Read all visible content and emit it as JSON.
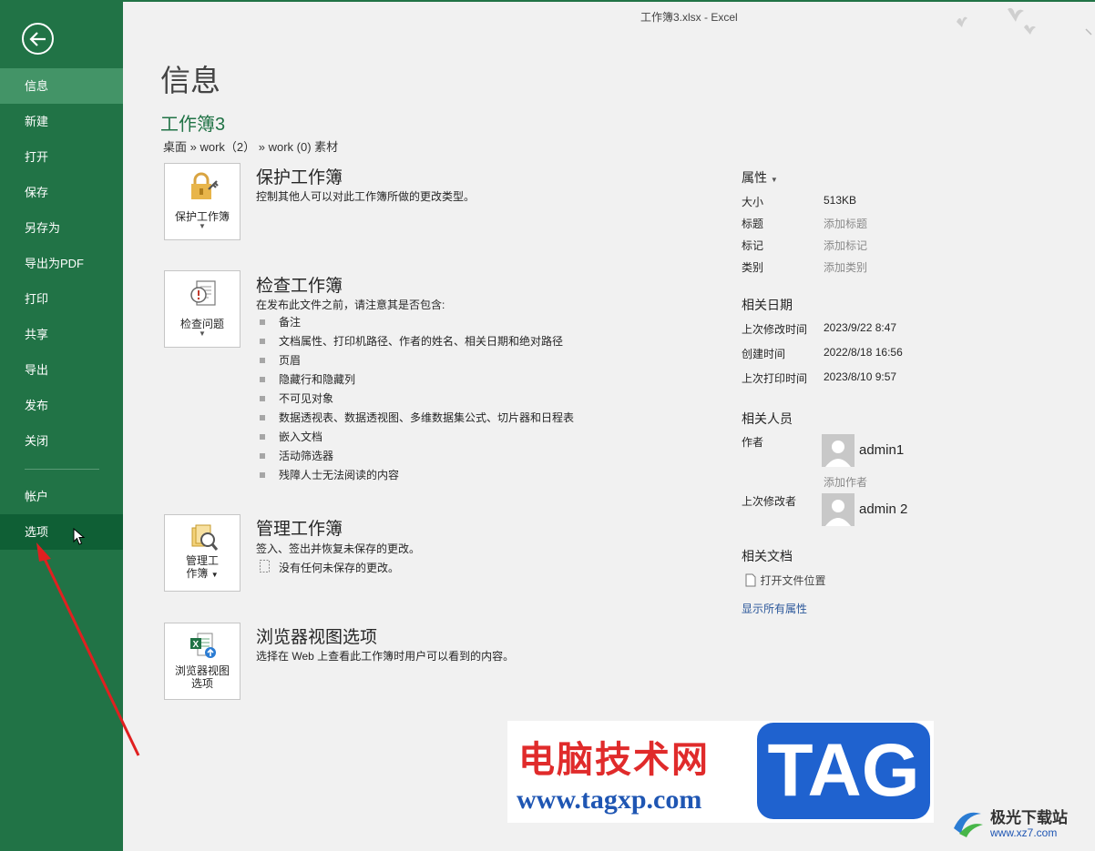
{
  "window": {
    "title": "工作簿3.xlsx - Excel"
  },
  "sidebar": {
    "items": [
      {
        "label": "信息",
        "top": 0
      },
      {
        "label": "新建"
      },
      {
        "label": "打开"
      },
      {
        "label": "保存"
      },
      {
        "label": "另存为"
      },
      {
        "label": "导出为PDF"
      },
      {
        "label": "打印"
      },
      {
        "label": "共享"
      },
      {
        "label": "导出"
      },
      {
        "label": "发布"
      },
      {
        "label": "关闭"
      }
    ],
    "account": "帐户",
    "options": "选项"
  },
  "main": {
    "heading": "信息",
    "doc_name": "工作簿3",
    "path": "桌面 » work（2） » work (0) 素材",
    "protect": {
      "tile_label": "保护工作簿",
      "title": "保护工作簿",
      "desc": "控制其他人可以对此工作簿所做的更改类型。"
    },
    "inspect": {
      "tile_label": "检查问题",
      "title": "检查工作簿",
      "desc": "在发布此文件之前，请注意其是否包含:",
      "bullets": [
        "备注",
        "文档属性、打印机路径、作者的姓名、相关日期和绝对路径",
        "页眉",
        "隐藏行和隐藏列",
        "不可见对象",
        "数据透视表、数据透视图、多维数据集公式、切片器和日程表",
        "嵌入文档",
        "活动筛选器",
        "残障人士无法阅读的内容"
      ]
    },
    "manage": {
      "tile_line1": "管理工",
      "tile_line2": "作簿",
      "title": "管理工作簿",
      "desc": "签入、签出并恢复未保存的更改。",
      "note": "没有任何未保存的更改。"
    },
    "browser": {
      "tile_line1": "浏览器视图",
      "tile_line2": "选项",
      "title": "浏览器视图选项",
      "desc": "选择在 Web 上查看此工作簿时用户可以看到的内容。"
    }
  },
  "properties": {
    "header": "属性",
    "size_label": "大小",
    "size_value": "513KB",
    "title_label": "标题",
    "title_placeholder": "添加标题",
    "tags_label": "标记",
    "tags_placeholder": "添加标记",
    "category_label": "类别",
    "category_placeholder": "添加类别",
    "dates_header": "相关日期",
    "modified_label": "上次修改时间",
    "modified_value": "2023/9/22 8:47",
    "created_label": "创建时间",
    "created_value": "2022/8/18 16:56",
    "printed_label": "上次打印时间",
    "printed_value": "2023/8/10 9:57",
    "people_header": "相关人员",
    "author_label": "作者",
    "author_name": "admin1",
    "add_author": "添加作者",
    "modifier_label": "上次修改者",
    "modifier_name": "admin 2",
    "docs_header": "相关文档",
    "open_location": "打开文件位置",
    "show_all": "显示所有属性"
  },
  "watermark": {
    "title": "电脑技术网",
    "url": "www.tagxp.com",
    "tag": "TAG",
    "site_name": "极光下载站",
    "site_url": "www.xz7.com"
  },
  "colors": {
    "accent": "#217346",
    "active": "#439467",
    "hover": "#0f5f35",
    "link": "#2b579a"
  }
}
